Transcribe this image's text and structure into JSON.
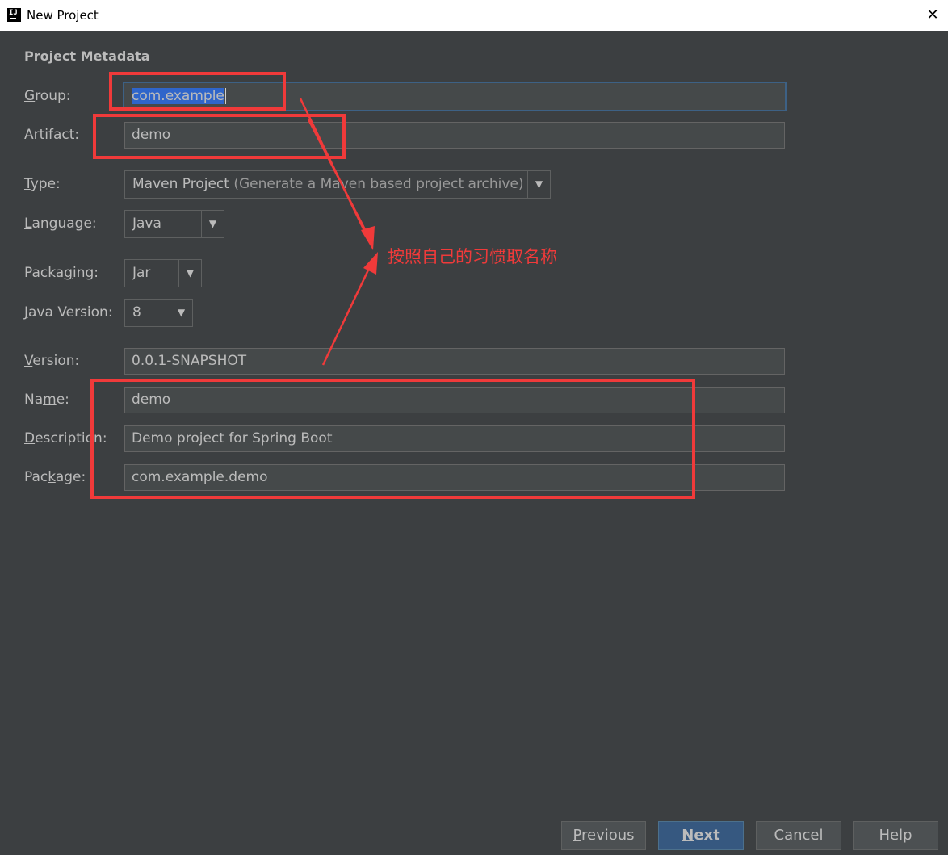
{
  "window": {
    "title": "New Project",
    "close_glyph": "✕",
    "app_icon_text": "IJ"
  },
  "section_title": "Project Metadata",
  "fields": {
    "group": {
      "label_pre": "",
      "label_mnemonic": "G",
      "label_post": "roup:",
      "value": "com.example"
    },
    "artifact": {
      "label_pre": "",
      "label_mnemonic": "A",
      "label_post": "rtifact:",
      "value": "demo"
    },
    "type": {
      "label_pre": "",
      "label_mnemonic": "T",
      "label_post": "ype:",
      "value": "Maven Project",
      "hint": "(Generate a Maven based project archive)"
    },
    "language": {
      "label_pre": "",
      "label_mnemonic": "L",
      "label_post": "anguage:",
      "value": "Java"
    },
    "packaging": {
      "label_pre": "Packa",
      "label_mnemonic": "g",
      "label_post": "ing:",
      "value": "Jar"
    },
    "java_version": {
      "label_pre": "",
      "label_mnemonic": "J",
      "label_post": "ava Version:",
      "value": "8"
    },
    "version": {
      "label_pre": "",
      "label_mnemonic": "V",
      "label_post": "ersion:",
      "value": "0.0.1-SNAPSHOT"
    },
    "name": {
      "label_pre": "Na",
      "label_mnemonic": "m",
      "label_post": "e:",
      "value": "demo"
    },
    "description": {
      "label_pre": "",
      "label_mnemonic": "D",
      "label_post": "escription:",
      "value": "Demo project for Spring Boot"
    },
    "package": {
      "label_pre": "Pac",
      "label_mnemonic": "k",
      "label_post": "age:",
      "value": "com.example.demo"
    }
  },
  "dropdown_arrow": "▼",
  "annotation": {
    "text": "按照自己的习惯取名称",
    "color": "#f03a3a"
  },
  "buttons": {
    "previous": {
      "mnemonic": "P",
      "rest": "revious"
    },
    "next": {
      "mnemonic": "N",
      "rest": "ext"
    },
    "cancel": "Cancel",
    "help": "Help"
  },
  "colors": {
    "background": "#3c3f41",
    "input_bg": "#45494a",
    "text": "#bbbbbb",
    "primary_button": "#365880",
    "selection": "#2f65ca"
  }
}
